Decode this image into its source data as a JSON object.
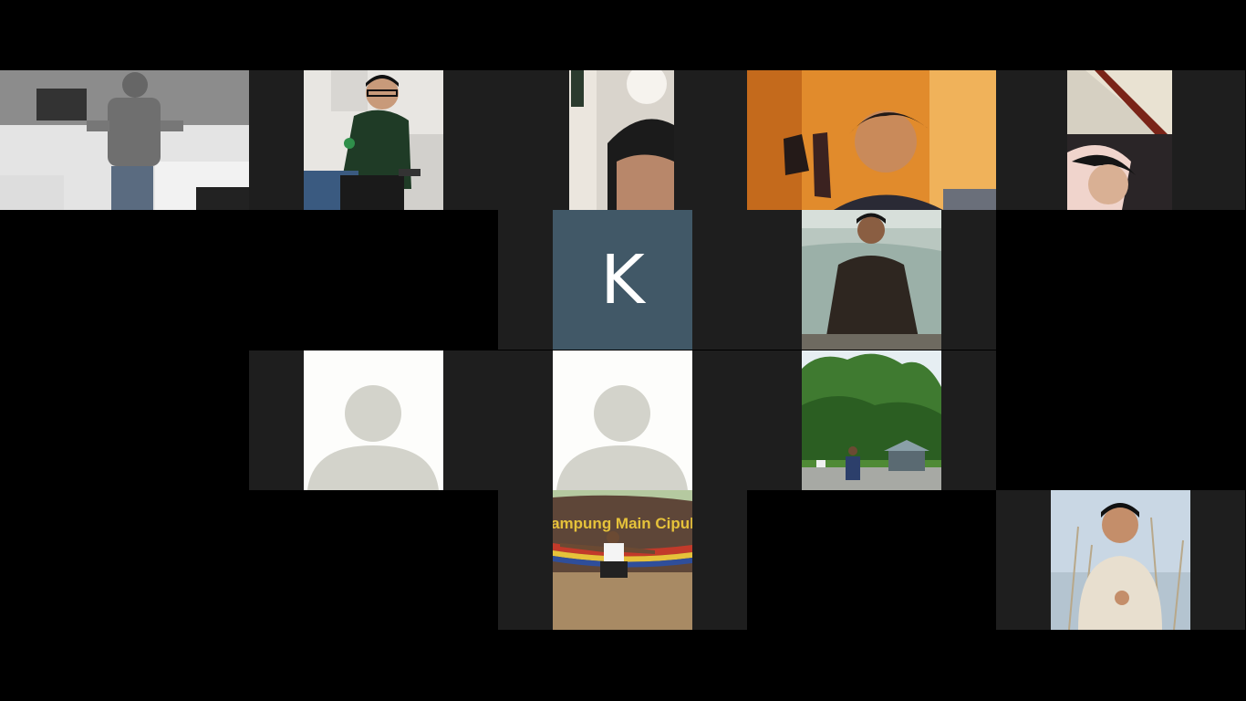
{
  "app": "Video conference gallery view",
  "colors": {
    "background": "#000000",
    "tile_background": "#1e1e1e",
    "initial_avatar_bg": "#415867",
    "placeholder_bg": "#fdfdfb",
    "placeholder_figure": "#d3d3cb"
  },
  "tiles": [
    {
      "id": "r1c1",
      "kind": "video"
    },
    {
      "id": "r1c2",
      "kind": "video"
    },
    {
      "id": "r1c3",
      "kind": "video"
    },
    {
      "id": "r1c4",
      "kind": "video"
    },
    {
      "id": "r1c5",
      "kind": "video"
    },
    {
      "id": "r2c3",
      "kind": "initial",
      "initial": "K"
    },
    {
      "id": "r2c4",
      "kind": "video"
    },
    {
      "id": "r3c2",
      "kind": "placeholder",
      "icon": "default-avatar-icon"
    },
    {
      "id": "r3c3",
      "kind": "placeholder",
      "icon": "default-avatar-icon"
    },
    {
      "id": "r3c4",
      "kind": "video"
    },
    {
      "id": "r4c3",
      "kind": "video",
      "sign_text": "Kampung Main Cipulir"
    },
    {
      "id": "r4c5",
      "kind": "video"
    }
  ]
}
